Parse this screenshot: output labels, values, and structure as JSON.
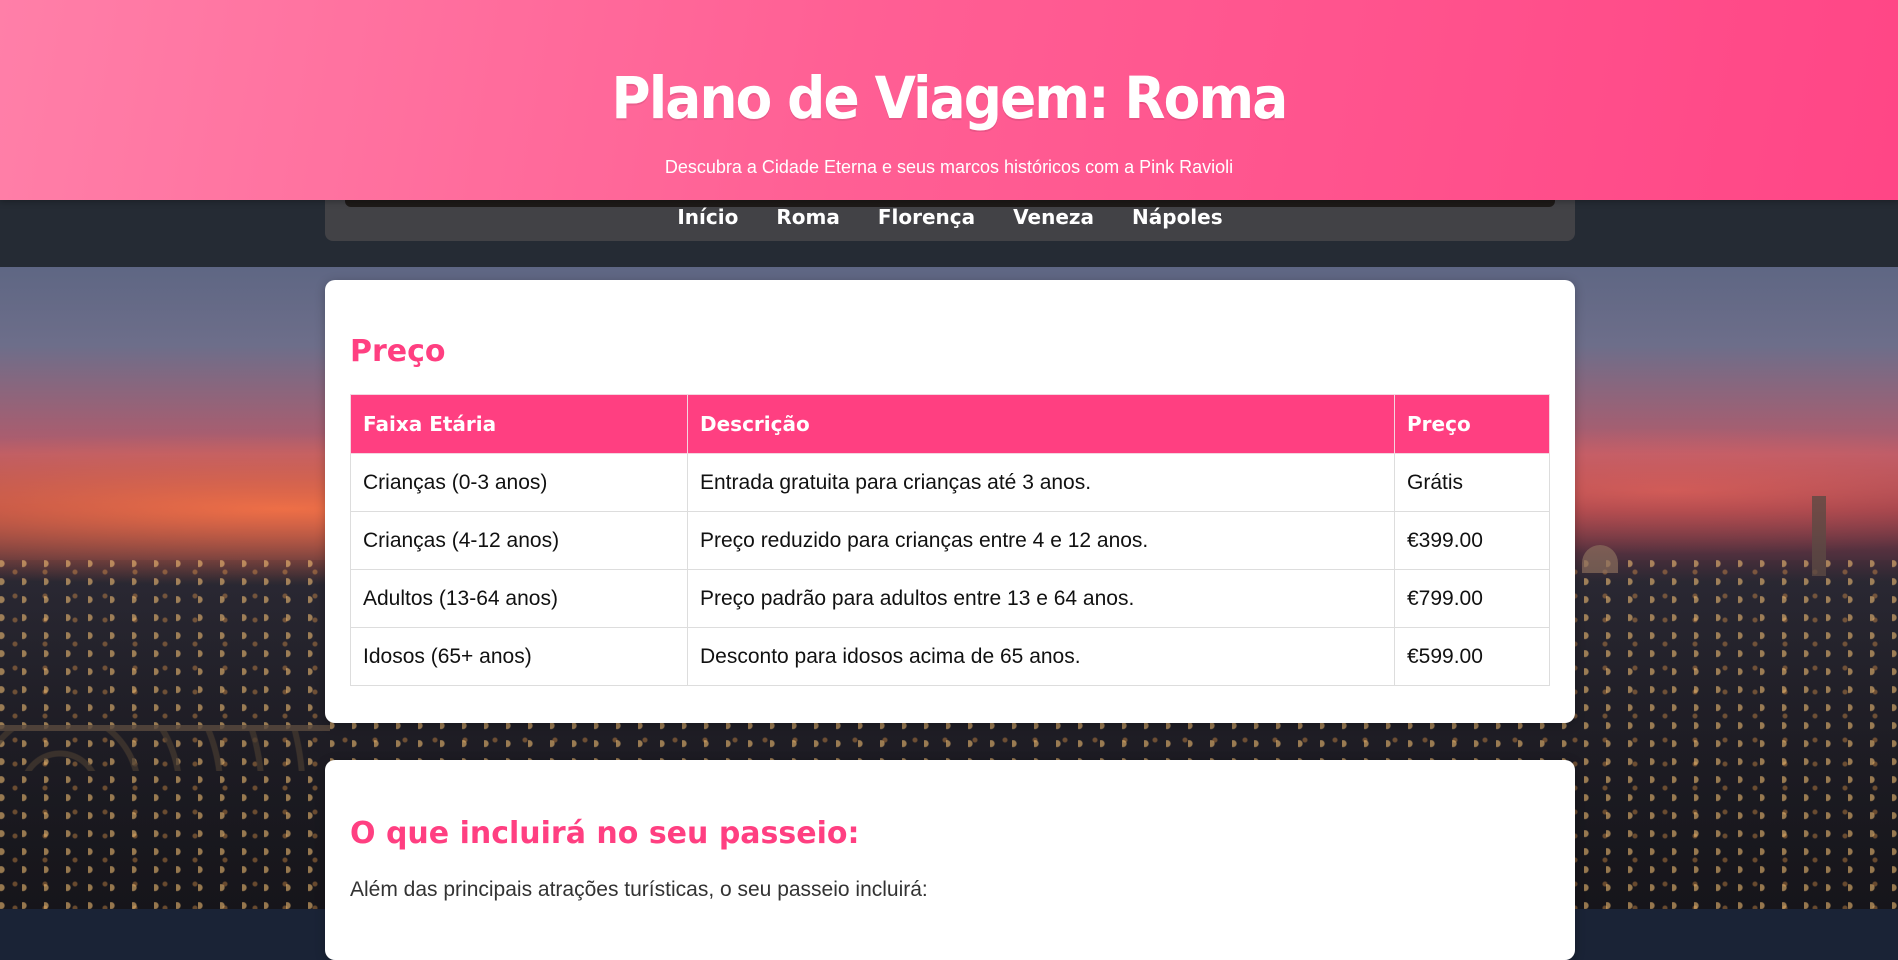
{
  "header": {
    "title": "Plano de Viagem: Roma",
    "subtitle": "Descubra a Cidade Eterna e seus marcos históricos com a Pink Ravioli"
  },
  "nav": {
    "items": [
      "Início",
      "Roma",
      "Florença",
      "Veneza",
      "Nápoles"
    ]
  },
  "price_section": {
    "title": "Preço",
    "columns": [
      "Faixa Etária",
      "Descrição",
      "Preço"
    ],
    "rows": [
      [
        "Crianças (0-3 anos)",
        "Entrada gratuita para crianças até 3 anos.",
        "Grátis"
      ],
      [
        "Crianças (4-12 anos)",
        "Preço reduzido para crianças entre 4 e 12 anos.",
        "€399.00"
      ],
      [
        "Adultos (13-64 anos)",
        "Preço padrão para adultos entre 13 e 64 anos.",
        "€799.00"
      ],
      [
        "Idosos (65+ anos)",
        "Desconto para idosos acima de 65 anos.",
        "€599.00"
      ]
    ]
  },
  "include_section": {
    "title": "O que incluirá no seu passeio:",
    "intro": "Além das principais atrações turísticas, o seu passeio incluirá:"
  },
  "colors": {
    "accent": "#ff3f81",
    "header_start": "#ff7fa8",
    "header_end": "#ff4686",
    "nav_bg": "#424246"
  }
}
